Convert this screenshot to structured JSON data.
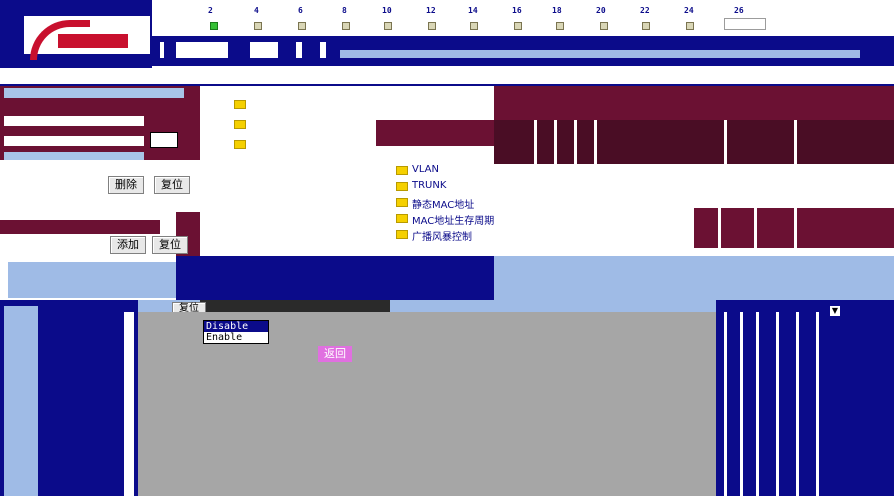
{
  "ports": {
    "numbers": [
      "2",
      "4",
      "6",
      "8",
      "10",
      "12",
      "14",
      "16",
      "18",
      "20",
      "22",
      "24",
      "26"
    ],
    "status": [
      "up",
      "down",
      "down",
      "down",
      "down",
      "down",
      "down",
      "down",
      "down",
      "down",
      "down",
      "down",
      "down"
    ]
  },
  "tree": {
    "items": [
      {
        "label": "VLAN"
      },
      {
        "label": "TRUNK"
      },
      {
        "label": "静态MAC地址"
      },
      {
        "label": "MAC地址生存周期"
      },
      {
        "label": "广播风暴控制"
      }
    ]
  },
  "buttons": {
    "delete": "删除",
    "reset_top": "复位",
    "add": "添加",
    "reset_mid": "复位",
    "reset_bottom": "复位"
  },
  "select": {
    "options": [
      "Disable",
      "Enable"
    ],
    "selected": "Disable"
  },
  "links": {
    "return": "返回"
  },
  "colors": {
    "navy": "#0b0b8a",
    "maroon": "#6b1133",
    "light_blue": "#9fbbe6",
    "gray": "#a6a6a6",
    "led_up": "#36c036",
    "return_pink": "#e070e0"
  }
}
